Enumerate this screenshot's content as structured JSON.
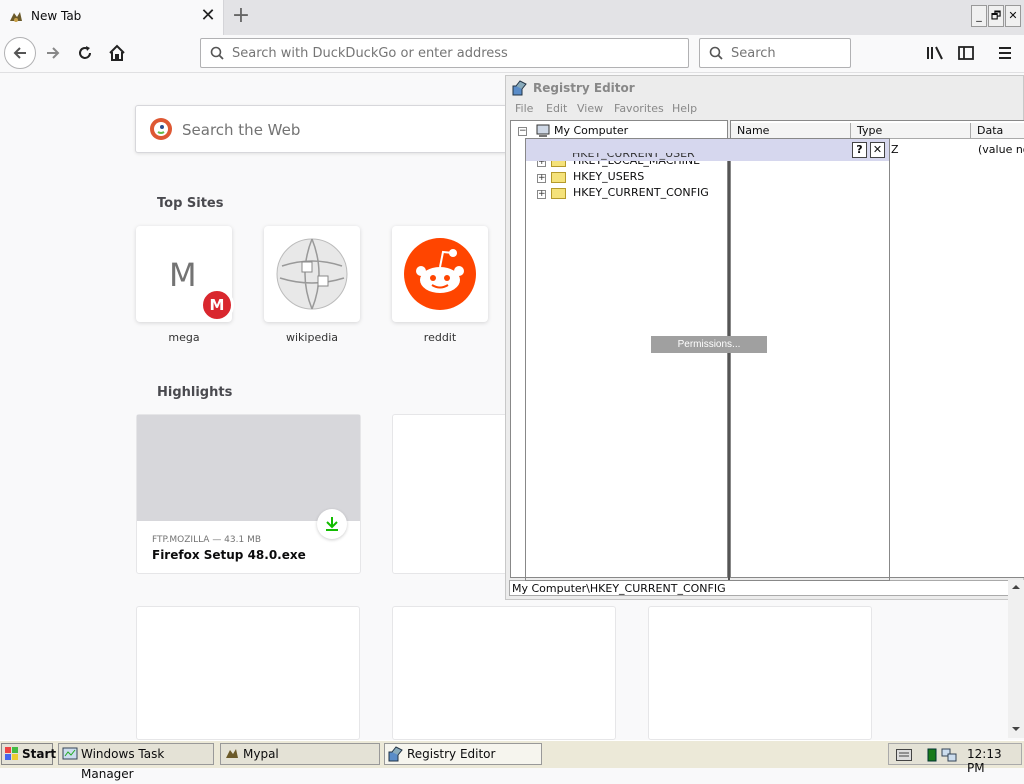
{
  "browser": {
    "tab_title": "New Tab",
    "tab_close": "✕",
    "new_tab": "+",
    "window_buttons": [
      "_",
      "🗗",
      "✕"
    ],
    "url_placeholder": "Search with DuckDuckGo or enter address",
    "search_placeholder": "Search"
  },
  "newtab": {
    "search_placeholder": "Search the Web",
    "top_sites_title": "Top Sites",
    "top_sites": [
      {
        "label": "mega",
        "letter": "M",
        "badge": "M"
      },
      {
        "label": "wikipedia"
      },
      {
        "label": "reddit"
      }
    ],
    "highlights_title": "Highlights",
    "highlight": {
      "source": "FTP.MOZILLA — 43.1 MB",
      "title": "Firefox Setup 48.0.exe"
    }
  },
  "regedit": {
    "title": "Registry Editor",
    "menu": [
      "File",
      "Edit",
      "View",
      "Favorites",
      "Help"
    ],
    "tree_root": "My Computer",
    "tree_items": [
      "HKEY_CURRENT_USER",
      "HKEY_LOCAL_MACHINE",
      "HKEY_USERS",
      "HKEY_CURRENT_CONFIG"
    ],
    "columns": [
      "Name",
      "Type",
      "Data"
    ],
    "row_type_partial": "Z",
    "row_data": "(value no",
    "status": "My Computer\\HKEY_CURRENT_CONFIG"
  },
  "dialog": {
    "help": "?",
    "close": "✕",
    "permissions_button": "Permissions..."
  },
  "taskbar": {
    "start": "Start",
    "tasks": [
      "Windows Task Manager",
      "Mypal",
      "Registry Editor"
    ],
    "clock": "12:13 PM"
  }
}
